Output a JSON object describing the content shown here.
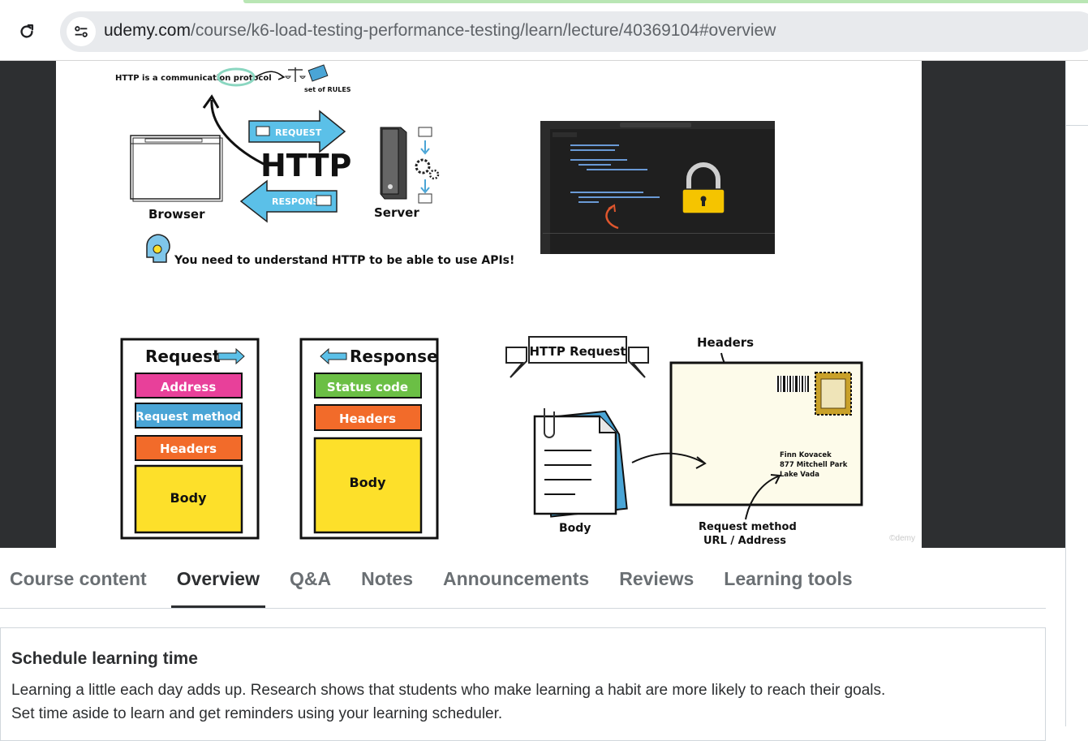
{
  "browser": {
    "url_host": "udemy.com",
    "url_path": "/course/k6-load-testing-performance-testing/learn/lecture/40369104#overview"
  },
  "slide": {
    "http_note": "HTTP is a communication protocol",
    "rules_label": "set of RULES",
    "request_arrow": "REQUEST",
    "response_arrow": "RESPONSE",
    "http_big": "HTTP",
    "browser_label": "Browser",
    "server_label": "Server",
    "api_note": "You need to understand HTTP to be able to use APIs!",
    "request_box": {
      "title": "Request",
      "items": [
        "Address",
        "Request method",
        "Headers",
        "Body"
      ]
    },
    "response_box": {
      "title": "Response",
      "items": [
        "Status code",
        "Headers",
        "Body"
      ]
    },
    "http_request_banner": "HTTP Request",
    "headers_label": "Headers",
    "address_lines": [
      "Finn Kovacek",
      "877 Mitchell Park",
      "Lake Vada"
    ],
    "body_label": "Body",
    "method_label_1": "Request method",
    "method_label_2": "URL / Address",
    "watermark": "©demy"
  },
  "tabs": [
    {
      "label": "Course content",
      "active": false
    },
    {
      "label": "Overview",
      "active": true
    },
    {
      "label": "Q&A",
      "active": false
    },
    {
      "label": "Notes",
      "active": false
    },
    {
      "label": "Announcements",
      "active": false
    },
    {
      "label": "Reviews",
      "active": false
    },
    {
      "label": "Learning tools",
      "active": false
    }
  ],
  "schedule": {
    "title": "Schedule learning time",
    "line1": "Learning a little each day adds up. Research shows that students who make learning a habit are more likely to reach their goals.",
    "line2": "Set time aside to learn and get reminders using your learning scheduler."
  },
  "colors": {
    "address": "#e8409a",
    "request_method": "#4aa5d6",
    "headers": "#f26b2a",
    "body": "#fde02a",
    "status_code": "#6bbf45",
    "arrow_blue": "#5bc0e8"
  },
  "icons": [
    "reload-icon",
    "site-info-icon",
    "lock-icon",
    "scales-icon",
    "book-icon",
    "gear-icon",
    "envelope-icon",
    "paperclip-icon",
    "head-bulb-icon"
  ]
}
